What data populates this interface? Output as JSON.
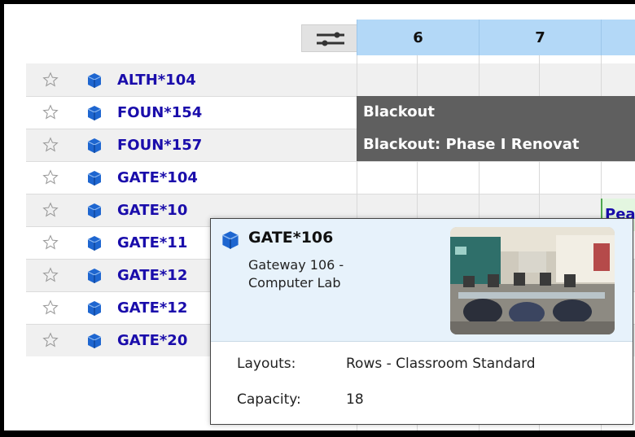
{
  "header": {
    "hours": [
      "6",
      "7",
      ""
    ]
  },
  "rooms": [
    {
      "code": "ALTH*104"
    },
    {
      "code": "FOUN*154"
    },
    {
      "code": "FOUN*157"
    },
    {
      "code": "GATE*104"
    },
    {
      "code": "GATE*10"
    },
    {
      "code": "GATE*11"
    },
    {
      "code": "GATE*12"
    },
    {
      "code": "GATE*12"
    },
    {
      "code": "GATE*20"
    }
  ],
  "events": {
    "foun154": "Blackout",
    "foun157": "Blackout: Phase I Renovat",
    "gate104": "Pea"
  },
  "popup": {
    "title": "GATE*106",
    "subtitle": "Gateway 106 - Computer Lab",
    "layouts_label": "Layouts:",
    "layouts_value": "Rows - Classroom Standard",
    "capacity_label": "Capacity:",
    "capacity_value": "18"
  },
  "colors": {
    "link": "#1a0dab",
    "room_icon": "#1e66d0",
    "hour_header": "#b3d8f7",
    "blackout": "#5f5f5f",
    "popup_bg": "#e7f2fb"
  },
  "icons": {
    "filter": "sliders-icon",
    "favorite": "star-outline-icon",
    "room": "cube-icon"
  }
}
